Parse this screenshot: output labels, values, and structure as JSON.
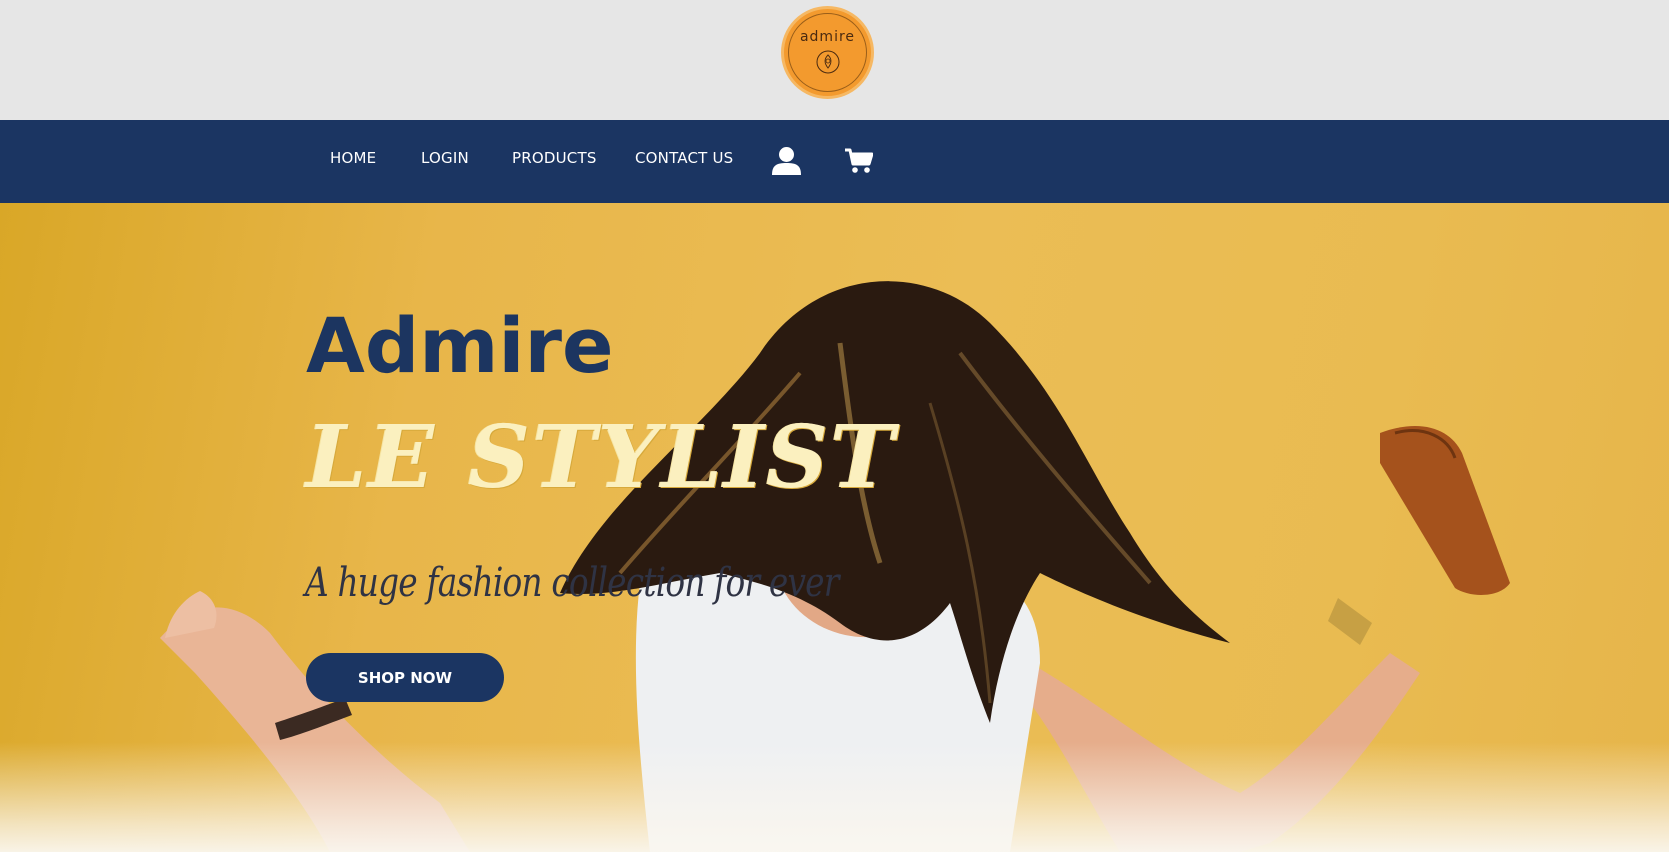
{
  "header": {
    "logo_text": "admire"
  },
  "nav": {
    "items": [
      {
        "label": "HOME"
      },
      {
        "label": "LOGIN"
      },
      {
        "label": "PRODUCTS"
      },
      {
        "label": "CONTACT US"
      }
    ],
    "icons": [
      "user-icon",
      "cart-icon"
    ]
  },
  "hero": {
    "title": "Admire",
    "subtitle": "LE STYLIST",
    "tagline": "A huge fashion collection for ever",
    "cta_label": "SHOP NOW"
  },
  "colors": {
    "navy": "#1b3562",
    "logo_orange": "#f39a2e",
    "hero_yellow": "#e8b64a",
    "stylist_cream": "#fbf0bf"
  }
}
